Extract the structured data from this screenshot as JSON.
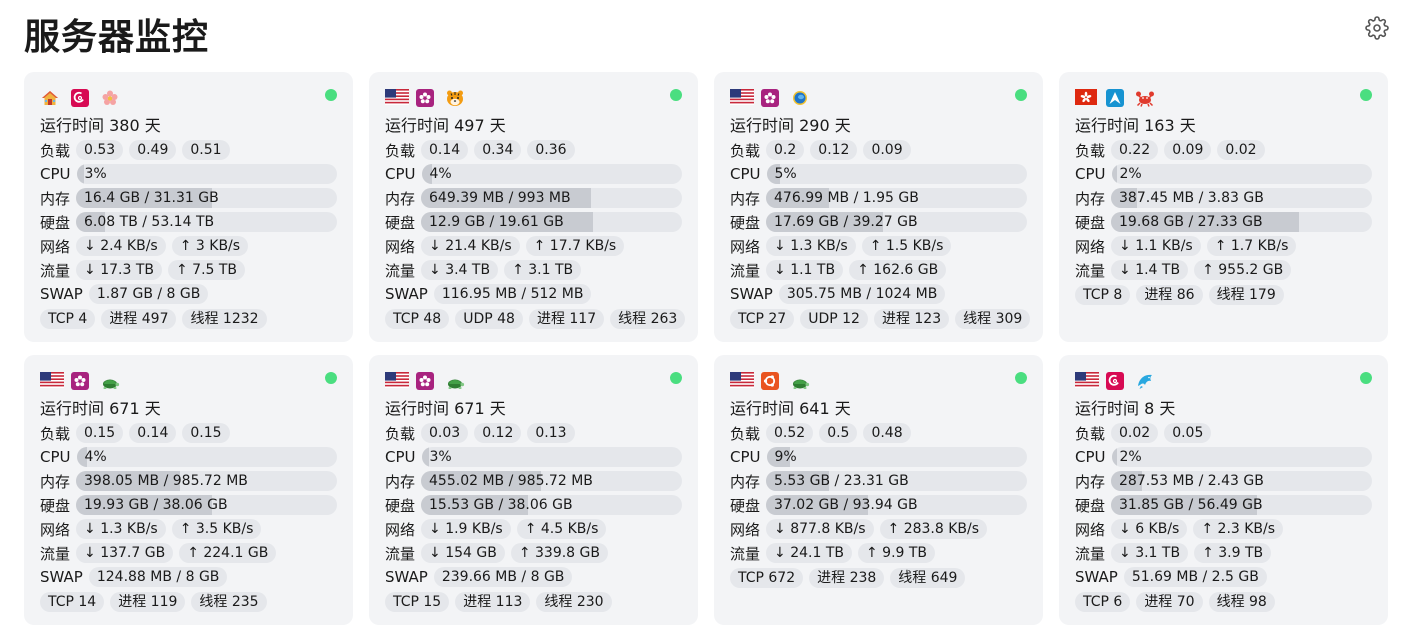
{
  "page": {
    "title": "服务器监控"
  },
  "labels": {
    "uptime_prefix": "运行时间",
    "uptime_suffix": "天",
    "load": "负载",
    "cpu": "CPU",
    "mem": "内存",
    "disk": "硬盘",
    "net": "网络",
    "traffic": "流量",
    "swap": "SWAP"
  },
  "colors": {
    "online": "#4ade80",
    "card_bg": "#f3f4f6",
    "pill_bg": "#e5e7eb",
    "bar_fill": "#c8cbd1"
  },
  "servers": [
    {
      "icons": [
        "house-icon",
        "debian-icon",
        "flower-icon"
      ],
      "uptime": "380",
      "load": [
        "0.53",
        "0.49",
        "0.51"
      ],
      "cpu": {
        "text": "3%",
        "pct": 3
      },
      "mem": {
        "text": "16.4 GB / 31.31 GB",
        "pct": 52
      },
      "disk": {
        "text": "6.08 TB / 53.14 TB",
        "pct": 11
      },
      "net_down": "↓ 2.4 KB/s",
      "net_up": "↑ 3 KB/s",
      "traffic_down": "↓ 17.3 TB",
      "traffic_up": "↑ 7.5 TB",
      "swap": "1.87 GB / 8 GB",
      "tags": [
        "TCP 4",
        "进程 497",
        "线程 1232"
      ]
    },
    {
      "icons": [
        "us-flag-icon",
        "rocky-icon",
        "tiger-icon"
      ],
      "uptime": "497",
      "load": [
        "0.14",
        "0.34",
        "0.36"
      ],
      "cpu": {
        "text": "4%",
        "pct": 4
      },
      "mem": {
        "text": "649.39 MB / 993 MB",
        "pct": 65
      },
      "disk": {
        "text": "12.9 GB / 19.61 GB",
        "pct": 66
      },
      "net_down": "↓ 21.4 KB/s",
      "net_up": "↑ 17.7 KB/s",
      "traffic_down": "↓ 3.4 TB",
      "traffic_up": "↑ 3.1 TB",
      "swap": "116.95 MB / 512 MB",
      "tags": [
        "TCP 48",
        "UDP 48",
        "进程 117",
        "线程 263"
      ]
    },
    {
      "icons": [
        "us-flag-icon",
        "rocky-icon",
        "globe-icon"
      ],
      "uptime": "290",
      "load": [
        "0.2",
        "0.12",
        "0.09"
      ],
      "cpu": {
        "text": "5%",
        "pct": 5
      },
      "mem": {
        "text": "476.99 MB / 1.95 GB",
        "pct": 24
      },
      "disk": {
        "text": "17.69 GB / 39.27 GB",
        "pct": 45
      },
      "net_down": "↓ 1.3 KB/s",
      "net_up": "↑ 1.5 KB/s",
      "traffic_down": "↓ 1.1 TB",
      "traffic_up": "↑ 162.6 GB",
      "swap": "305.75 MB / 1024 MB",
      "tags": [
        "TCP 27",
        "UDP 12",
        "进程 123",
        "线程 309"
      ]
    },
    {
      "icons": [
        "hk-flag-icon",
        "arch-icon",
        "crab-icon"
      ],
      "uptime": "163",
      "load": [
        "0.22",
        "0.09",
        "0.02"
      ],
      "cpu": {
        "text": "2%",
        "pct": 2
      },
      "mem": {
        "text": "387.45 MB / 3.83 GB",
        "pct": 10
      },
      "disk": {
        "text": "19.68 GB / 27.33 GB",
        "pct": 72
      },
      "net_down": "↓ 1.1 KB/s",
      "net_up": "↑ 1.7 KB/s",
      "traffic_down": "↓ 1.4 TB",
      "traffic_up": "↑ 955.2 GB",
      "swap": "",
      "tags": [
        "TCP 8",
        "进程 86",
        "线程 179"
      ]
    },
    {
      "icons": [
        "us-flag-icon",
        "rocky-icon",
        "turtle-icon"
      ],
      "uptime": "671",
      "load": [
        "0.15",
        "0.14",
        "0.15"
      ],
      "cpu": {
        "text": "4%",
        "pct": 4
      },
      "mem": {
        "text": "398.05 MB / 985.72 MB",
        "pct": 40
      },
      "disk": {
        "text": "19.93 GB / 38.06 GB",
        "pct": 52
      },
      "net_down": "↓ 1.3 KB/s",
      "net_up": "↑ 3.5 KB/s",
      "traffic_down": "↓ 137.7 GB",
      "traffic_up": "↑ 224.1 GB",
      "swap": "124.88 MB / 8 GB",
      "tags": [
        "TCP 14",
        "进程 119",
        "线程 235"
      ]
    },
    {
      "icons": [
        "us-flag-icon",
        "rocky-icon",
        "turtle-icon"
      ],
      "uptime": "671",
      "load": [
        "0.03",
        "0.12",
        "0.13"
      ],
      "cpu": {
        "text": "3%",
        "pct": 3
      },
      "mem": {
        "text": "455.02 MB / 985.72 MB",
        "pct": 46
      },
      "disk": {
        "text": "15.53 GB / 38.06 GB",
        "pct": 41
      },
      "net_down": "↓ 1.9 KB/s",
      "net_up": "↑ 4.5 KB/s",
      "traffic_down": "↓ 154 GB",
      "traffic_up": "↑ 339.8 GB",
      "swap": "239.66 MB / 8 GB",
      "tags": [
        "TCP 15",
        "进程 113",
        "线程 230"
      ]
    },
    {
      "icons": [
        "us-flag-icon",
        "ubuntu-icon",
        "turtle-icon"
      ],
      "uptime": "641",
      "load": [
        "0.52",
        "0.5",
        "0.48"
      ],
      "cpu": {
        "text": "9%",
        "pct": 9
      },
      "mem": {
        "text": "5.53 GB / 23.31 GB",
        "pct": 24
      },
      "disk": {
        "text": "37.02 GB / 93.94 GB",
        "pct": 39
      },
      "net_down": "↓ 877.8 KB/s",
      "net_up": "↑ 283.8 KB/s",
      "traffic_down": "↓ 24.1 TB",
      "traffic_up": "↑ 9.9 TB",
      "swap": "",
      "tags": [
        "TCP 672",
        "进程 238",
        "线程 649"
      ]
    },
    {
      "icons": [
        "us-flag-icon",
        "debian-icon",
        "dolphin-icon"
      ],
      "uptime": "8",
      "load": [
        "0.02",
        "0.05"
      ],
      "cpu": {
        "text": "2%",
        "pct": 2
      },
      "mem": {
        "text": "287.53 MB / 2.43 GB",
        "pct": 12
      },
      "disk": {
        "text": "31.85 GB / 56.49 GB",
        "pct": 56
      },
      "net_down": "↓ 6 KB/s",
      "net_up": "↑ 2.3 KB/s",
      "traffic_down": "↓ 3.1 TB",
      "traffic_up": "↑ 3.9 TB",
      "swap": "51.69 MB / 2.5 GB",
      "tags": [
        "TCP 6",
        "进程 70",
        "线程 98"
      ]
    }
  ]
}
